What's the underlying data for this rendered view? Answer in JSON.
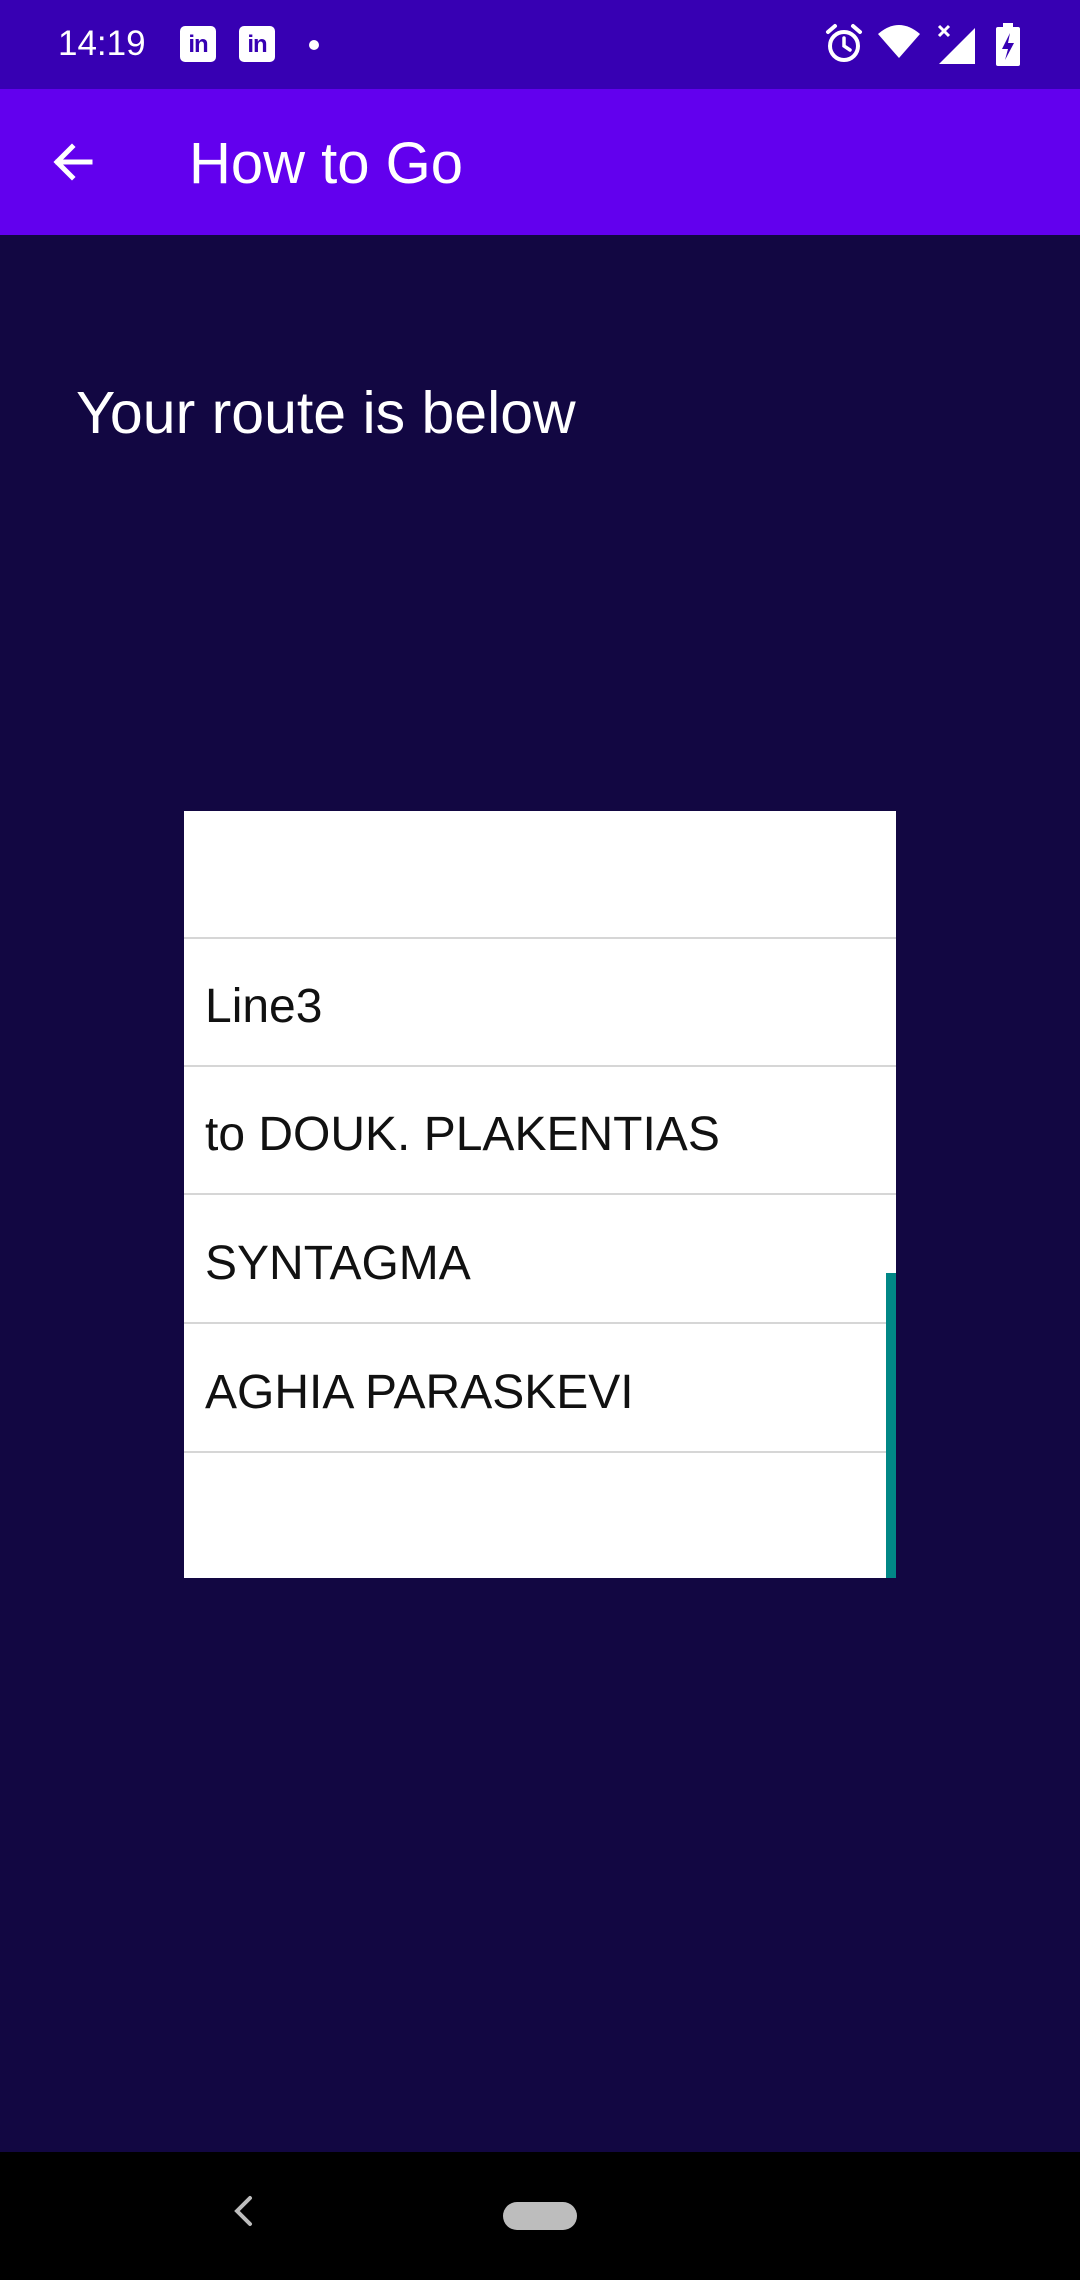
{
  "status_bar": {
    "time": "14:19",
    "notification_icons": [
      "linkedin-icon",
      "linkedin-icon",
      "dot-icon"
    ],
    "linkedin_glyph": "in",
    "system_icons": [
      "alarm-icon",
      "wifi-icon",
      "signal-icon",
      "battery-charging-icon"
    ]
  },
  "app_bar": {
    "back_icon": "arrow-back-icon",
    "title": "How to Go"
  },
  "main": {
    "heading": "Your route is below",
    "route_items": [
      "",
      "Line3",
      "to DOUK. PLAKENTIAS",
      "SYNTAGMA",
      "AGHIA PARASKEVI",
      ""
    ]
  },
  "colors": {
    "status_bar": "#3700B3",
    "app_bar": "#6200EE",
    "background": "#120742",
    "scroll_thumb": "#018786"
  },
  "nav_bar": {
    "buttons": [
      "back-icon",
      "home-pill-icon"
    ]
  }
}
